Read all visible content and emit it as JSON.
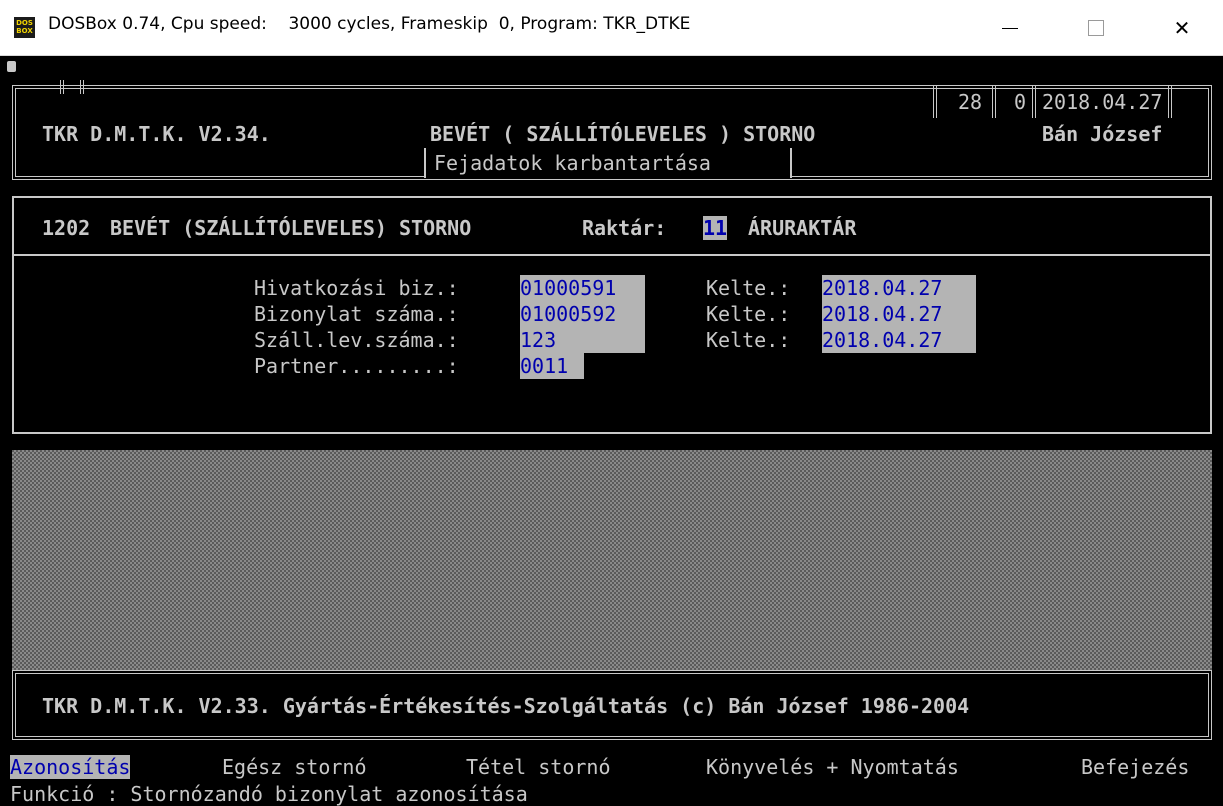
{
  "window": {
    "icon_text": "DOS BOX",
    "title": "DOSBox 0.74, Cpu speed:    3000 cycles, Frameskip  0, Program: TKR_DTKE",
    "minimize": "—",
    "maximize": "☐",
    "close": "✕"
  },
  "header": {
    "app_version": "TKR D.M.T.K. V2.34.",
    "module_title": "BEVÉT ( SZÁLLÍTÓLEVELES ) STORNO",
    "user": "Bán József",
    "num1": "28",
    "num2": "0",
    "date": "2018.04.27",
    "subtitle": "Fejadatok karbantartása"
  },
  "form": {
    "code": "1202",
    "doc_type": "BEVÉT (SZÁLLÍTÓLEVELES) STORNO",
    "warehouse_label": "Raktár:",
    "warehouse_code": "11",
    "warehouse_name": "ÁRURAKTÁR",
    "rows": [
      {
        "label": "Hivatkozási biz.:",
        "value": "01000591",
        "date_label": "Kelte.:",
        "date": "2018.04.27"
      },
      {
        "label": "Bizonylat száma.:",
        "value": "01000592",
        "date_label": "Kelte.:",
        "date": "2018.04.27"
      },
      {
        "label": "Száll.lev.száma.:",
        "value": "123",
        "date_label": "Kelte.:",
        "date": "2018.04.27"
      },
      {
        "label": "Partner.........:",
        "value": "0011"
      }
    ]
  },
  "footer": {
    "copyright": "TKR D.M.T.K. V2.33. Gyártás-Értékesítés-Szolgáltatás (c) Bán József 1986-2004"
  },
  "menu": {
    "items": [
      "Azonosítás",
      "Egész stornó",
      "Tétel stornó",
      "Könyvelés + Nyomtatás",
      "Befejezés"
    ],
    "active_index": 0,
    "status": "Funkció : Stornózandó bizonylat azonosítása"
  },
  "colors": {
    "screen_bg": "#000000",
    "text": "#c8c8c8",
    "field_bg": "#b4b4b4",
    "field_text": "#0000ae"
  }
}
